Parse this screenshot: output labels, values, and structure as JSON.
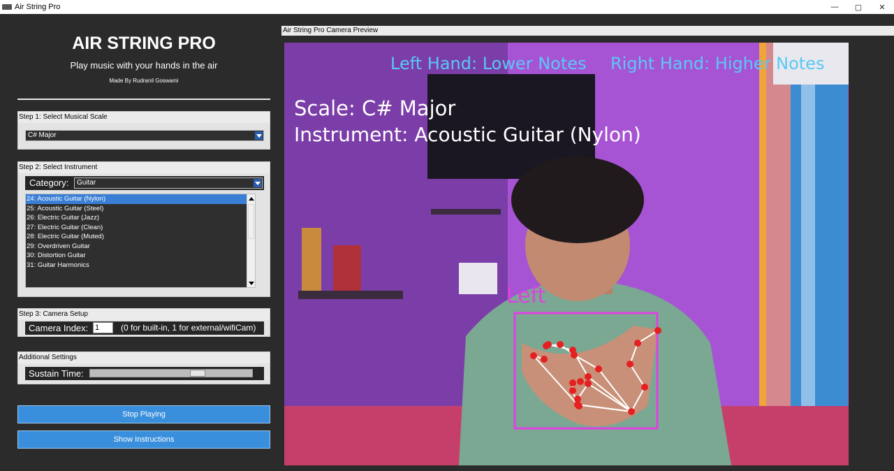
{
  "window": {
    "title": "Air String Pro",
    "controls": [
      "—",
      "▢",
      "✕"
    ]
  },
  "app": {
    "title": "AIR STRING PRO",
    "subtitle": "Play music with your hands in the air",
    "credit": "Made By Rudranil Goswami"
  },
  "step1": {
    "header": "Step 1: Select Musical Scale",
    "scale_value": "C# Major"
  },
  "step2": {
    "header": "Step 2: Select Instrument",
    "category_label": "Category:",
    "category_value": "Guitar",
    "instruments": [
      {
        "label": "24: Acoustic Guitar (Nylon)",
        "selected": true
      },
      {
        "label": "25: Acoustic Guitar (Steel)",
        "selected": false
      },
      {
        "label": "26: Electric Guitar (Jazz)",
        "selected": false
      },
      {
        "label": "27: Electric Guitar (Clean)",
        "selected": false
      },
      {
        "label": "28: Electric Guitar (Muted)",
        "selected": false
      },
      {
        "label": "29: Overdriven Guitar",
        "selected": false
      },
      {
        "label": "30: Distortion Guitar",
        "selected": false
      },
      {
        "label": "31: Guitar Harmonics",
        "selected": false
      }
    ]
  },
  "step3": {
    "header": "Step 3: Camera Setup",
    "index_label": "Camera Index:",
    "index_value": "1",
    "hint": "(0 for built-in, 1 for external/wifiCam)"
  },
  "settings": {
    "header": "Additional Settings",
    "sustain_label": "Sustain Time:",
    "sustain_level": 0.68
  },
  "buttons": {
    "stop": "Stop Playing",
    "instructions": "Show Instructions"
  },
  "preview": {
    "header": "Air String Pro  Camera Preview",
    "overlay": {
      "left_hand": "Left Hand: Lower Notes",
      "right_hand": "Right Hand: Higher Notes",
      "scale": "Scale: C# Major",
      "instrument": "Instrument: Acoustic Guitar (Nylon)",
      "hand_label": "Left"
    }
  },
  "colors": {
    "accent": "#3a8fdc",
    "overlay_cyan": "#5ac8f5",
    "overlay_magenta": "#e040e0",
    "landmark_red": "#e52020"
  }
}
